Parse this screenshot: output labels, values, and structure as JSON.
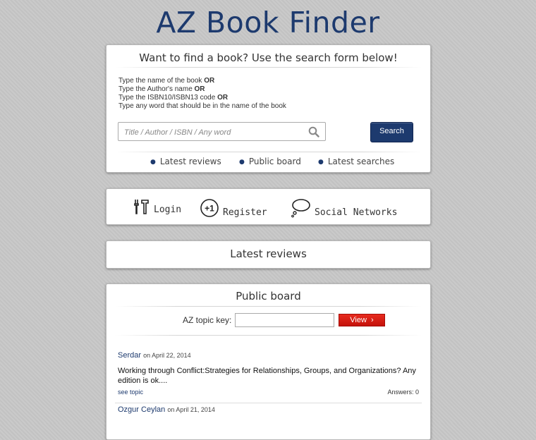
{
  "site_title": "AZ Book Finder",
  "search": {
    "heading": "Want to find a book? Use the search form below!",
    "instructions": [
      {
        "text": "Type the name of the book ",
        "bold": "OR"
      },
      {
        "text": "Type the Author's name ",
        "bold": "OR"
      },
      {
        "text": "Type the ISBN10/ISBN13 code ",
        "bold": "OR"
      },
      {
        "text": "Type any word that should be in the name of the book",
        "bold": ""
      }
    ],
    "placeholder": "Title / Author / ISBN / Any word",
    "button_label": "Search",
    "icon": "search-icon"
  },
  "links": [
    "Latest reviews",
    "Public board",
    "Latest searches"
  ],
  "account": {
    "login_label": "Login",
    "register_label": "Register",
    "social_label": "Social Networks",
    "register_badge": "+1"
  },
  "reviews": {
    "heading": "Latest reviews"
  },
  "board": {
    "heading": "Public board",
    "topic_label": "AZ topic key:",
    "view_label": "View",
    "view_arrow": "›",
    "posts": [
      {
        "user": "Serdar",
        "date": "on April 22, 2014",
        "message": "Working through Conflict:Strategies for Relationships, Groups, and Organizations? Any edition is ok....",
        "see_topic": "see topic",
        "answers": "Answers: 0"
      },
      {
        "user": "Ozgur Ceylan",
        "date": "on April 21, 2014"
      }
    ]
  },
  "colors": {
    "brand": "#1d3a6e",
    "view_button": "#d81d13"
  }
}
